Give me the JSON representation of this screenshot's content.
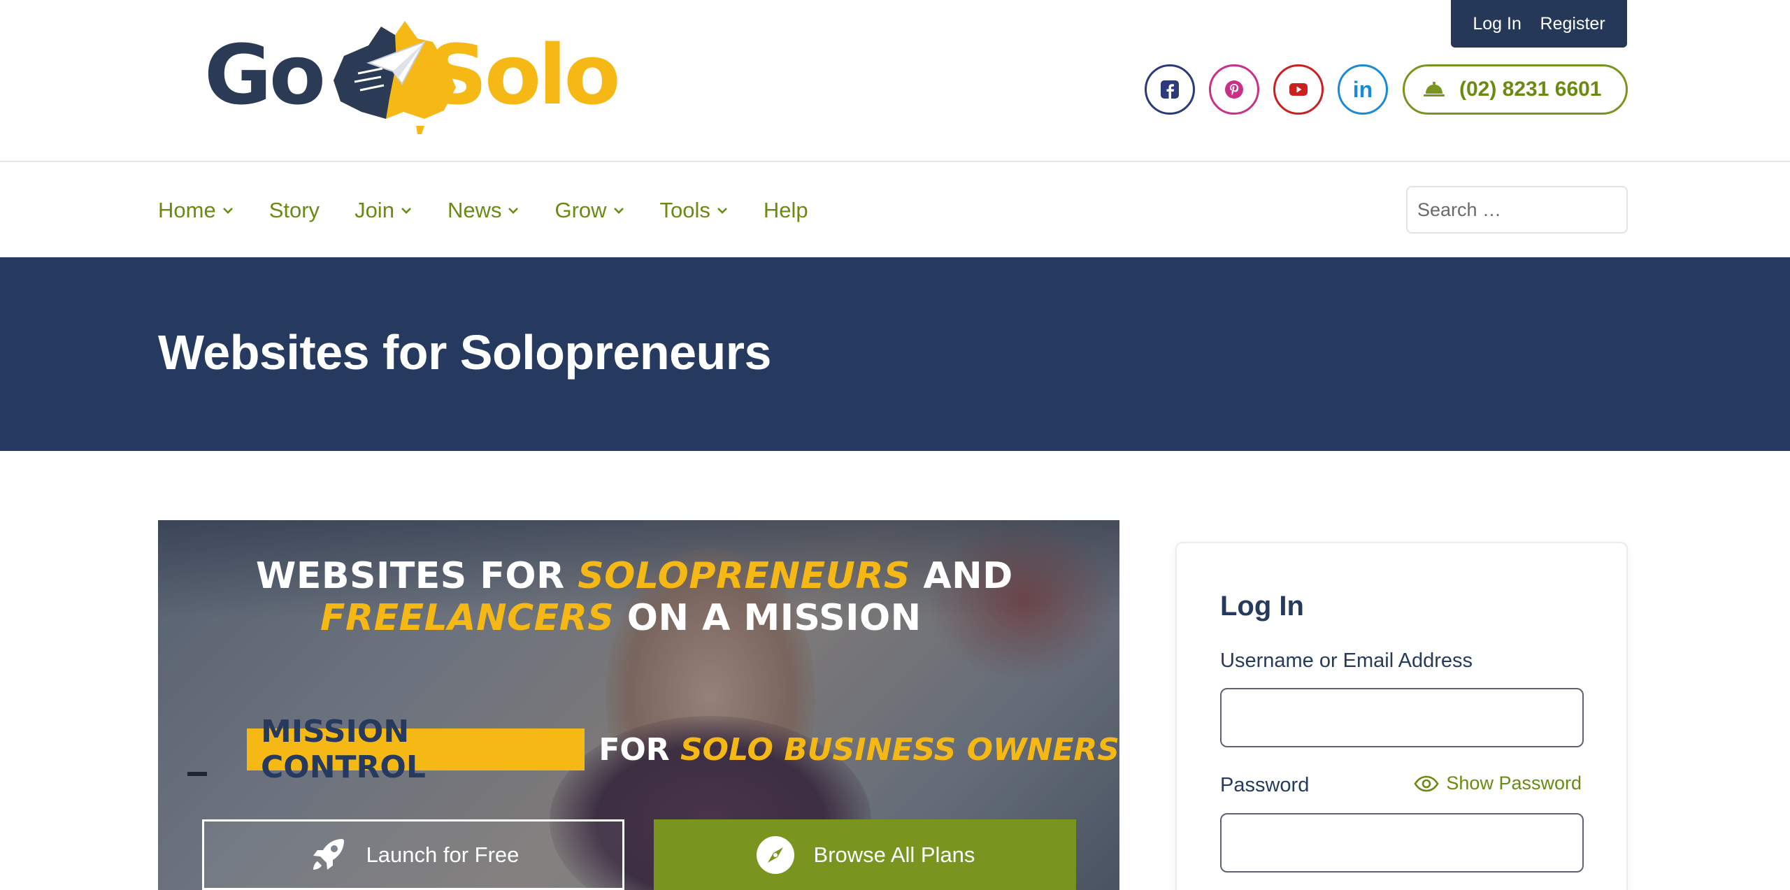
{
  "brand": {
    "logo_text_left": "Go",
    "logo_text_right": "Solo"
  },
  "account": {
    "login_label": "Log In",
    "register_label": "Register"
  },
  "social": [
    {
      "name": "facebook-icon",
      "color": "#2b3a7a"
    },
    {
      "name": "pinterest-icon",
      "color": "#c8308a"
    },
    {
      "name": "youtube-icon",
      "color": "#cc1f1f"
    },
    {
      "name": "linkedin-icon",
      "color": "#1b8ad6",
      "glyph": "in"
    }
  ],
  "phone": {
    "icon": "service-bell-icon",
    "number": "(02) 8231 6601"
  },
  "nav": {
    "items": [
      {
        "label": "Home",
        "has_dropdown": true
      },
      {
        "label": "Story",
        "has_dropdown": false
      },
      {
        "label": "Join",
        "has_dropdown": true
      },
      {
        "label": "News",
        "has_dropdown": true
      },
      {
        "label": "Grow",
        "has_dropdown": true
      },
      {
        "label": "Tools",
        "has_dropdown": true
      },
      {
        "label": "Help",
        "has_dropdown": false
      }
    ],
    "search_placeholder": "Search …"
  },
  "banner": {
    "title": "Websites for Solopreneurs"
  },
  "hero": {
    "line1_a": "WEBSITES FOR ",
    "line1_accent": "SOLOPRENEURS",
    "line1_b": " AND",
    "line2_accent": "FREELANCERS",
    "line2_b": " ON A MISSION",
    "mission_box": "MISSION CONTROL",
    "mission_for": "FOR ",
    "mission_accent": "SOLO BUSINESS OWNERS",
    "launch_label": "Launch for Free",
    "browse_label": "Browse All Plans"
  },
  "login": {
    "title": "Log In",
    "username_label": "Username or Email Address",
    "username_value": "",
    "password_label": "Password",
    "password_value": "",
    "show_password_label": "Show Password"
  },
  "colors": {
    "navy": "#253a5e",
    "green": "#7a9420",
    "gold": "#f5b815"
  }
}
